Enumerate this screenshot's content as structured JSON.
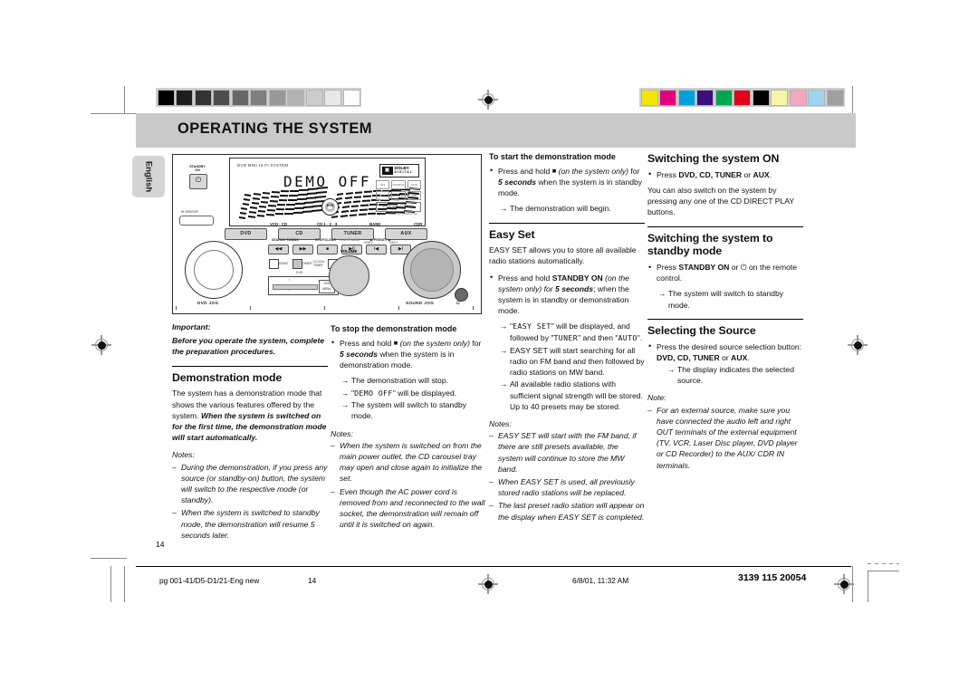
{
  "header": {
    "title": "OPERATING THE SYSTEM",
    "language_tab": "English"
  },
  "device": {
    "brand_label": "DVD MINI HI-FI SYSTEM",
    "display_text": "DEMO OFF",
    "dolby_mark": "DOLBY",
    "dolby_sub": "D I G I T A L",
    "standby_label": "STANDBY\nON",
    "ir_label": "IR SENSOR",
    "source_labels_top": [
      "VCD · CD",
      "CD 1 · 2 · 3",
      "BAND",
      "CDR"
    ],
    "source_buttons": [
      "DVD",
      "CD",
      "TUNER",
      "AUX"
    ],
    "control_labels": [
      "SEARCH TUNING",
      "STOP/CLEAR",
      "PLAY/PAUSE",
      "PREV",
      "NEXT",
      "PRESET"
    ],
    "control_buttons": [
      "◀◀",
      "▶▶",
      "■",
      "▶ II",
      "I◀",
      "▶I"
    ],
    "left_jog_label": "DVD JOG",
    "right_jog_label": "SOUND JOG",
    "volume_label": "VOLUME",
    "dvd_slider_label": "DVD",
    "dvd_menu_label": "DVD\nMENU",
    "small_button_labels": [
      "DEMO",
      "TIMER",
      "CLOCK/TIMER"
    ],
    "remote_keys": [
      "OFF",
      "SOURCE",
      "SKIP",
      "SUB",
      "CHANNEL",
      "DIM"
    ],
    "remote_wide": "SURROUND CONTROL",
    "remote_sub": "L-TOP / REVERSE / SUBWOOFER",
    "headphone_label": "Ω"
  },
  "col1": {
    "important_head": "Important:",
    "important_body": "Before you operate the system, complete the preparation procedures.",
    "demo_title": "Demonstration mode",
    "demo_p1_plain": "The system has a demonstration mode that shows the various features offered by the system.",
    "demo_p1_bold": "When the system is switched on for the first time, the demonstration mode will start automatically.",
    "notes_label": "Notes:",
    "notes": [
      "During the demonstration, if you press any source (or standby-on) button, the system will switch to the respective mode (or standby).",
      "When the system is switched to standby mode, the demonstration will resume 5 seconds later."
    ]
  },
  "col2": {
    "stop_head": "To stop the demonstration mode",
    "stop_bullet_a": "Press and hold",
    "stop_bullet_sq": "■",
    "stop_bullet_b": "(on the system only)",
    "stop_bullet_c": "for",
    "stop_bullet_sec": "5 seconds",
    "stop_bullet_d": "when the system is in demonstration mode.",
    "stop_arrows": [
      "The demonstration will stop.",
      "\"DEMO OFF\" will be displayed.",
      "The system will switch to standby mode."
    ],
    "stop_arrow2_lcd": "DEMO OFF",
    "notes_label": "Notes:",
    "notes": [
      "When the system is switched on from the main power outlet, the CD carousel tray may open and close again to initialize the set.",
      "Even though the AC power cord is removed from and reconnected to the wall socket, the demonstration will remain off until it is switched on again."
    ]
  },
  "col3": {
    "start_head": "To start the demonstration mode",
    "start_bullet_a": "Press and hold",
    "start_bullet_sq": "■",
    "start_bullet_b": "(on the system only)",
    "start_bullet_c": "for",
    "start_bullet_sec": "5 seconds",
    "start_bullet_d": "when the system is in standby mode.",
    "start_arrow": "The demonstration will begin.",
    "easyset_title": "Easy Set",
    "easyset_p1": "EASY SET allows you to store all available radio stations automatically.",
    "easyset_bullet_a": "Press and hold",
    "easyset_bullet_bold": "STANDBY ON",
    "easyset_bullet_it1": "(on the system only)",
    "easyset_bullet_c": "for",
    "easyset_bullet_sec": "5 seconds",
    "easyset_bullet_d": "; when the system is in standby or demonstration mode.",
    "easyset_arrow1_pre": "\"",
    "easyset_arrow1_lcd1": "EASY SET",
    "easyset_arrow1_mid": "\" will be displayed, and followed by \"",
    "easyset_arrow1_lcd2": "TUNER",
    "easyset_arrow1_mid2": "\" and then \"",
    "easyset_arrow1_lcd3": "AUTO",
    "easyset_arrow1_end": "\".",
    "easyset_arrow2": "EASY SET will start searching for all radio on FM band and then followed by radio stations on MW band.",
    "easyset_arrow3": "All available radio stations with sufficient signal strength will be stored. Up to 40 presets may be stored.",
    "notes_label": "Notes:",
    "notes": [
      "EASY SET will start with the FM band, if there are still presets available, the system will continue to store the MW band.",
      "When EASY SET is used, all previously stored radio stations will be replaced.",
      "The last preset radio station will appear on the display when EASY SET is completed."
    ]
  },
  "col4": {
    "on_title": "Switching the system ON",
    "on_bullet_pre": "Press",
    "on_bullet_keys": "DVD, CD, TUNER",
    "on_bullet_or": "or",
    "on_bullet_aux": "AUX",
    "on_p1": "You can also switch on the system by pressing any one of the CD DIRECT PLAY buttons.",
    "standby_title": "Switching the system to standby mode",
    "standby_bullet_pre": "Press",
    "standby_bullet_key": "STANDBY ON",
    "standby_bullet_or": "or",
    "standby_bullet_icon": "⏻",
    "standby_bullet_post": "on the remote control.",
    "standby_arrow": "The system will switch to standby mode.",
    "source_title": "Selecting the Source",
    "source_bullet_pre": "Press the desired source selection button:",
    "source_bullet_keys": "DVD, CD, TUNER",
    "source_bullet_or": "or",
    "source_bullet_aux": "AUX",
    "source_arrow": "The display indicates the selected source.",
    "note_label": "Note:",
    "note": "For an external source, make sure you have connected the audio left and right OUT terminals of the external equipment (TV, VCR, Laser Disc player, DVD player or CD Recorder) to the AUX/ CDR IN terminals."
  },
  "footer": {
    "page_number": "14",
    "file_name": "pg 001-41/D5-D1/21-Eng new",
    "file_page": "14",
    "timestamp": "6/8/01, 11:32 AM",
    "doc_code": "3139 115 20054"
  },
  "marks": {
    "gray_bar": [
      "#000000",
      "#1e1e1e",
      "#333333",
      "#4d4d4d",
      "#676767",
      "#7f7f7f",
      "#999999",
      "#b2b2b2",
      "#cccccc",
      "#e8e8e8",
      "#ffffff"
    ],
    "color_bar": [
      "#f5e400",
      "#e2007e",
      "#00a0e0",
      "#3d0f7a",
      "#00a550",
      "#e2001a",
      "#000000",
      "#fbf3a6",
      "#f5a6c0",
      "#9fd4f2",
      "#a0a0a0"
    ]
  }
}
